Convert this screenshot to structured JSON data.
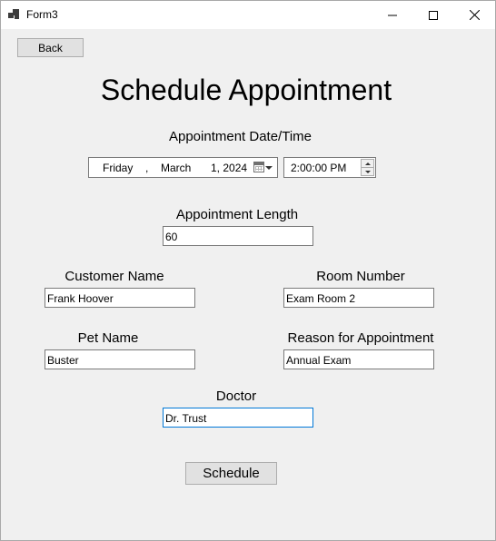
{
  "window": {
    "title": "Form3",
    "icon": "app-form-icon"
  },
  "title_controls": {
    "minimize": "minimize-icon",
    "maximize": "maximize-icon",
    "close": "close-icon"
  },
  "back_button": {
    "label": "Back"
  },
  "heading": "Schedule Appointment",
  "appointment_datetime": {
    "label": "Appointment Date/Time",
    "date": {
      "day": "Friday",
      "separator": ",",
      "month": "March",
      "date": "1, 2024",
      "icon": "calendar-icon"
    },
    "time": "2:00:00 PM"
  },
  "appointment_length": {
    "label": "Appointment Length",
    "value": "60"
  },
  "customer_name": {
    "label": "Customer Name",
    "value": "Frank Hoover"
  },
  "room_number": {
    "label": "Room Number",
    "value": "Exam Room 2"
  },
  "pet_name": {
    "label": "Pet Name",
    "value": "Buster"
  },
  "reason": {
    "label": "Reason for Appointment",
    "value": "Annual Exam"
  },
  "doctor": {
    "label": "Doctor",
    "value": "Dr. Trust"
  },
  "schedule_button": {
    "label": "Schedule"
  },
  "colors": {
    "window_bg": "#f0f0f0",
    "focus_border": "#0078d7",
    "button_bg": "#e1e1e1"
  }
}
